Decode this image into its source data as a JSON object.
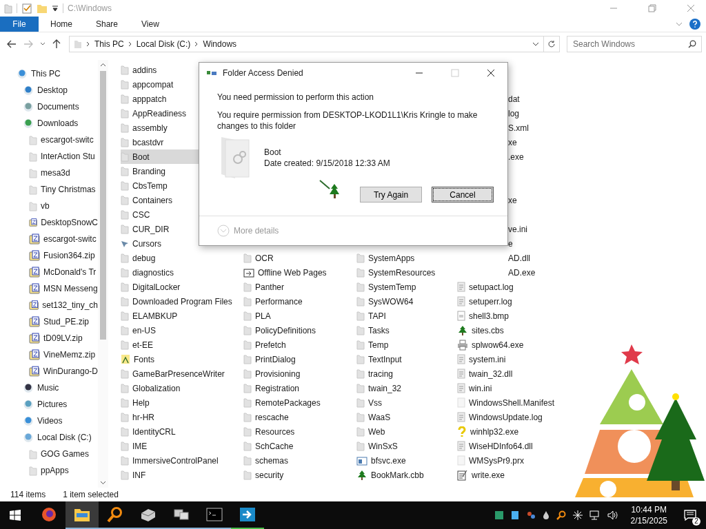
{
  "window": {
    "title": "C:\\Windows"
  },
  "ribbon": {
    "tabs": [
      {
        "label": "File",
        "kind": "file",
        "selected": false
      },
      {
        "label": "Home",
        "kind": "tab",
        "selected": false
      },
      {
        "label": "Share",
        "kind": "tab",
        "selected": false
      },
      {
        "label": "View",
        "kind": "tab",
        "selected": false
      }
    ]
  },
  "address": {
    "segments": [
      "This PC",
      "Local Disk (C:)",
      "Windows"
    ]
  },
  "search": {
    "placeholder": "Search Windows"
  },
  "sidebar": {
    "items": [
      {
        "label": "This PC",
        "kind": "pc",
        "selected": false,
        "children": [
          {
            "label": "Desktop",
            "kind": "desktop",
            "selected": false
          },
          {
            "label": "Documents",
            "kind": "documents",
            "selected": false
          },
          {
            "label": "Downloads",
            "kind": "downloads",
            "selected": false,
            "children": [
              {
                "label": "escargot-switc",
                "kind": "folder",
                "selected": false
              },
              {
                "label": "InterAction Stu",
                "kind": "folder",
                "selected": false
              },
              {
                "label": "mesa3d",
                "kind": "folder",
                "selected": false
              },
              {
                "label": "Tiny Christmas",
                "kind": "folder",
                "selected": false
              },
              {
                "label": "vb",
                "kind": "folder",
                "selected": false
              },
              {
                "label": "DesktopSnowC",
                "kind": "zip",
                "selected": false
              },
              {
                "label": "escargot-switc",
                "kind": "zip",
                "selected": false
              },
              {
                "label": "Fusion364.zip",
                "kind": "zip",
                "selected": false
              },
              {
                "label": "McDonald's Tr",
                "kind": "zip",
                "selected": false
              },
              {
                "label": "MSN Messeng",
                "kind": "zip",
                "selected": false
              },
              {
                "label": "set132_tiny_ch",
                "kind": "zip",
                "selected": false
              },
              {
                "label": "Stud_PE.zip",
                "kind": "zip",
                "selected": false
              },
              {
                "label": "tD09LV.zip",
                "kind": "zip",
                "selected": false
              },
              {
                "label": "VineMemz.zip",
                "kind": "zip",
                "selected": false
              },
              {
                "label": "WinDurango-D",
                "kind": "zip",
                "selected": false
              }
            ]
          },
          {
            "label": "Music",
            "kind": "music",
            "selected": false
          },
          {
            "label": "Pictures",
            "kind": "pictures",
            "selected": false
          },
          {
            "label": "Videos",
            "kind": "videos",
            "selected": false
          },
          {
            "label": "Local Disk (C:)",
            "kind": "drive",
            "selected": false,
            "children": [
              {
                "label": "GOG Games",
                "kind": "folder",
                "selected": false
              },
              {
                "label": "ppApps",
                "kind": "folder",
                "selected": false
              }
            ]
          }
        ]
      }
    ]
  },
  "files": {
    "columns": [
      {
        "items": [
          {
            "name": "addins",
            "kind": "folder",
            "selected": false
          },
          {
            "name": "appcompat",
            "kind": "folder",
            "selected": false
          },
          {
            "name": "apppatch",
            "kind": "folder",
            "selected": false
          },
          {
            "name": "AppReadiness",
            "kind": "folder",
            "selected": false
          },
          {
            "name": "assembly",
            "kind": "folder",
            "selected": false
          },
          {
            "name": "bcastdvr",
            "kind": "folder",
            "selected": false
          },
          {
            "name": "Boot",
            "kind": "folder",
            "selected": true
          },
          {
            "name": "Branding",
            "kind": "folder",
            "selected": false
          },
          {
            "name": "CbsTemp",
            "kind": "folder",
            "selected": false
          },
          {
            "name": "Containers",
            "kind": "folder",
            "selected": false
          },
          {
            "name": "CSC",
            "kind": "folder",
            "selected": false
          },
          {
            "name": "CUR_DIR",
            "kind": "folder",
            "selected": false
          },
          {
            "name": "Cursors",
            "kind": "cursor",
            "selected": false
          },
          {
            "name": "debug",
            "kind": "folder",
            "selected": false
          },
          {
            "name": "diagnostics",
            "kind": "folder",
            "selected": false
          },
          {
            "name": "DigitalLocker",
            "kind": "folder",
            "selected": false
          },
          {
            "name": "Downloaded Program Files",
            "kind": "folder",
            "selected": false
          },
          {
            "name": "ELAMBKUP",
            "kind": "folder",
            "selected": false
          },
          {
            "name": "en-US",
            "kind": "folder",
            "selected": false
          },
          {
            "name": "et-EE",
            "kind": "folder",
            "selected": false
          },
          {
            "name": "Fonts",
            "kind": "fonts",
            "selected": false
          },
          {
            "name": "GameBarPresenceWriter",
            "kind": "folder",
            "selected": false
          },
          {
            "name": "Globalization",
            "kind": "folder",
            "selected": false
          },
          {
            "name": "Help",
            "kind": "folder",
            "selected": false
          },
          {
            "name": "hr-HR",
            "kind": "folder",
            "selected": false
          },
          {
            "name": "IdentityCRL",
            "kind": "folder",
            "selected": false
          },
          {
            "name": "IME",
            "kind": "folder",
            "selected": false
          },
          {
            "name": "ImmersiveControlPanel",
            "kind": "folder",
            "selected": false
          },
          {
            "name": "INF",
            "kind": "folder",
            "selected": false
          }
        ]
      },
      {
        "items": [
          {
            "name": "OCR",
            "kind": "folder",
            "selected": false
          },
          {
            "name": "Offline Web Pages",
            "kind": "web",
            "selected": false
          },
          {
            "name": "Panther",
            "kind": "folder",
            "selected": false
          },
          {
            "name": "Performance",
            "kind": "folder",
            "selected": false
          },
          {
            "name": "PLA",
            "kind": "folder",
            "selected": false
          },
          {
            "name": "PolicyDefinitions",
            "kind": "folder",
            "selected": false
          },
          {
            "name": "Prefetch",
            "kind": "folder",
            "selected": false
          },
          {
            "name": "PrintDialog",
            "kind": "folder",
            "selected": false
          },
          {
            "name": "Provisioning",
            "kind": "folder",
            "selected": false
          },
          {
            "name": "Registration",
            "kind": "folder",
            "selected": false
          },
          {
            "name": "RemotePackages",
            "kind": "folder",
            "selected": false
          },
          {
            "name": "rescache",
            "kind": "folder",
            "selected": false
          },
          {
            "name": "Resources",
            "kind": "folder",
            "selected": false
          },
          {
            "name": "SchCache",
            "kind": "folder",
            "selected": false
          },
          {
            "name": "schemas",
            "kind": "folder",
            "selected": false
          },
          {
            "name": "security",
            "kind": "folder",
            "selected": false
          }
        ]
      },
      {
        "items": [
          {
            "name": "SystemApps",
            "kind": "folder",
            "selected": false
          },
          {
            "name": "SystemResources",
            "kind": "folder",
            "selected": false
          },
          {
            "name": "SystemTemp",
            "kind": "folder",
            "selected": false
          },
          {
            "name": "SysWOW64",
            "kind": "folder",
            "selected": false
          },
          {
            "name": "TAPI",
            "kind": "folder",
            "selected": false
          },
          {
            "name": "Tasks",
            "kind": "folder",
            "selected": false
          },
          {
            "name": "Temp",
            "kind": "folder",
            "selected": false
          },
          {
            "name": "TextInput",
            "kind": "folder",
            "selected": false
          },
          {
            "name": "tracing",
            "kind": "folder",
            "selected": false
          },
          {
            "name": "twain_32",
            "kind": "folder",
            "selected": false
          },
          {
            "name": "Vss",
            "kind": "folder",
            "selected": false
          },
          {
            "name": "WaaS",
            "kind": "folder",
            "selected": false
          },
          {
            "name": "Web",
            "kind": "folder",
            "selected": false
          },
          {
            "name": "WinSxS",
            "kind": "folder",
            "selected": false
          },
          {
            "name": "bfsvc.exe",
            "kind": "exe",
            "selected": false
          },
          {
            "name": "BookMark.cbb",
            "kind": "tree",
            "selected": false
          }
        ]
      },
      {
        "items": [
          {
            "name": "dat",
            "kind": "covered",
            "selected": false
          },
          {
            "name": "log",
            "kind": "covered",
            "selected": false
          },
          {
            "name": "S.xml",
            "kind": "covered",
            "selected": false
          },
          {
            "name": "xe",
            "kind": "covered",
            "selected": false
          },
          {
            "name": ".exe",
            "kind": "covered",
            "selected": false
          },
          {
            "kind": "covered",
            "selected": false
          },
          {
            "kind": "covered",
            "selected": false
          },
          {
            "name": "xe",
            "kind": "covered",
            "selected": false
          },
          {
            "kind": "covered",
            "selected": false
          },
          {
            "name": "ve.ini",
            "kind": "covered",
            "selected": false
          },
          {
            "name": "e",
            "kind": "covered",
            "selected": false
          },
          {
            "name": "AD.dll",
            "kind": "covered",
            "selected": false
          },
          {
            "name": "AD.exe",
            "kind": "covered",
            "selected": false
          },
          {
            "name": "setupact.log",
            "kind": "log",
            "selected": false
          },
          {
            "name": "setuperr.log",
            "kind": "log",
            "selected": false
          },
          {
            "name": "shell3.bmp",
            "kind": "image",
            "selected": false
          },
          {
            "name": "sites.cbs",
            "kind": "tree",
            "selected": false
          },
          {
            "name": "splwow64.exe",
            "kind": "printer",
            "selected": false
          },
          {
            "name": "system.ini",
            "kind": "settings",
            "selected": false
          },
          {
            "name": "twain_32.dll",
            "kind": "settings",
            "selected": false
          },
          {
            "name": "win.ini",
            "kind": "settings",
            "selected": false
          },
          {
            "name": "WindowsShell.Manifest",
            "kind": "document",
            "selected": false
          },
          {
            "name": "WindowsUpdate.log",
            "kind": "log",
            "selected": false
          },
          {
            "name": "winhlp32.exe",
            "kind": "help",
            "selected": false
          },
          {
            "name": "WiseHDInfo64.dll",
            "kind": "settings",
            "selected": false
          },
          {
            "name": "WMSysPr9.prx",
            "kind": "document",
            "selected": false
          },
          {
            "name": "write.exe",
            "kind": "write",
            "selected": false
          }
        ]
      }
    ]
  },
  "status_bar": {
    "item_count": "114 items",
    "selection": "1 item selected"
  },
  "dialog": {
    "title": "Folder Access Denied",
    "heading": "You need permission to perform this action",
    "message": "You require permission from DESKTOP-LKOD1L1\\Kris Kringle to make changes to this folder",
    "file_name": "Boot",
    "date": "Date created: 9/15/2018 12:33 AM",
    "buttons": [
      {
        "label": "Try Again",
        "focused": false
      },
      {
        "label": "Cancel",
        "focused": true
      }
    ],
    "details": "More details"
  },
  "taskbar": {
    "apps": [
      {
        "kind": "firefox",
        "active": false,
        "open": false
      },
      {
        "kind": "explorer",
        "active": true,
        "open": true
      },
      {
        "kind": "magnifier",
        "active": false,
        "open": true
      },
      {
        "kind": "drive",
        "active": false,
        "open": true
      },
      {
        "kind": "network",
        "active": false,
        "open": true
      },
      {
        "kind": "console",
        "active": false,
        "open": true
      },
      {
        "kind": "arrow",
        "active": false,
        "open": true
      }
    ],
    "time": "10:44 PM",
    "date": "2/15/2025",
    "notification_count": "2"
  }
}
